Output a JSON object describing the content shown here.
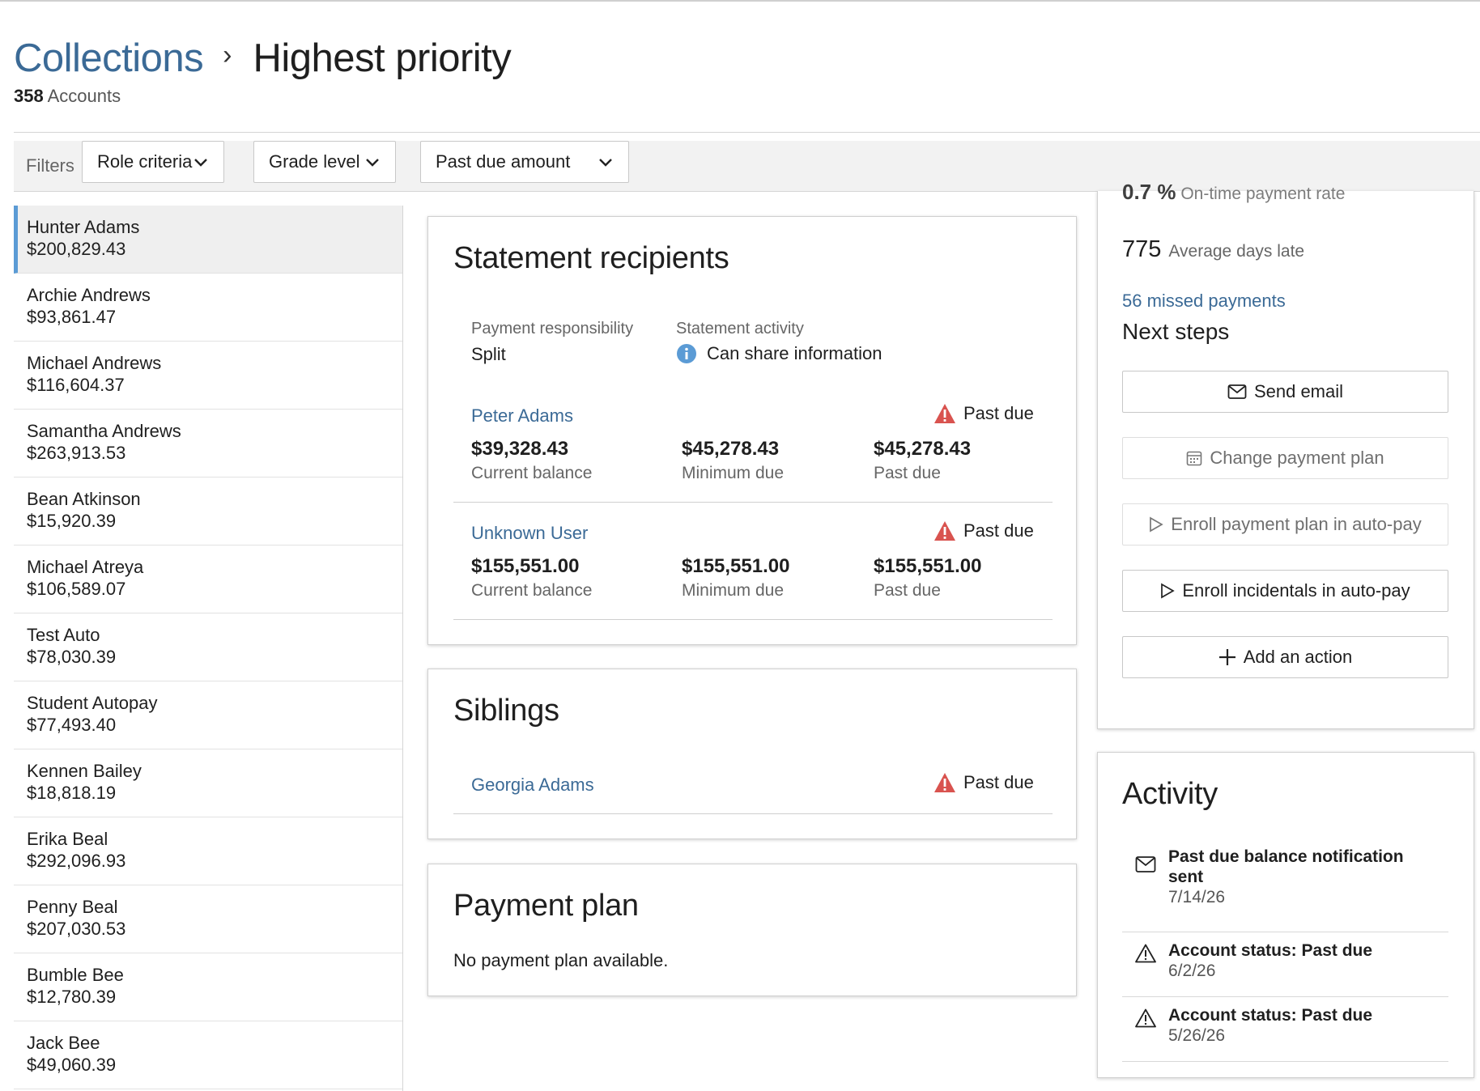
{
  "breadcrumb": {
    "parent": "Collections",
    "separator": "›",
    "current": "Highest priority"
  },
  "accounts_summary": {
    "count": "358",
    "label": "Accounts"
  },
  "filters": {
    "label": "Filters",
    "buttons": [
      "Role criteria",
      "Grade level",
      "Past due amount"
    ]
  },
  "account_list": [
    {
      "name": "Hunter Adams",
      "amount": "$200,829.43",
      "selected": true
    },
    {
      "name": "Archie Andrews",
      "amount": "$93,861.47"
    },
    {
      "name": "Michael Andrews",
      "amount": "$116,604.37"
    },
    {
      "name": "Samantha Andrews",
      "amount": "$263,913.53"
    },
    {
      "name": "Bean Atkinson",
      "amount": "$15,920.39"
    },
    {
      "name": "Michael Atreya",
      "amount": "$106,589.07"
    },
    {
      "name": "Test Auto",
      "amount": "$78,030.39"
    },
    {
      "name": "Student Autopay",
      "amount": "$77,493.40"
    },
    {
      "name": "Kennen Bailey",
      "amount": "$18,818.19"
    },
    {
      "name": "Erika Beal",
      "amount": "$292,096.93"
    },
    {
      "name": "Penny Beal",
      "amount": "$207,030.53"
    },
    {
      "name": "Bumble Bee",
      "amount": "$12,780.39"
    },
    {
      "name": "Jack Bee",
      "amount": "$49,060.39"
    }
  ],
  "statement_recipients": {
    "title": "Statement recipients",
    "payment_responsibility_label": "Payment responsibility",
    "payment_responsibility_value": "Split",
    "statement_activity_label": "Statement activity",
    "statement_activity_value": "Can share information",
    "recipients": [
      {
        "name": "Peter Adams",
        "status": "Past due",
        "current_balance": "$39,328.43",
        "current_balance_label": "Current balance",
        "minimum_due": "$45,278.43",
        "minimum_due_label": "Minimum due",
        "past_due": "$45,278.43",
        "past_due_label": "Past due"
      },
      {
        "name": "Unknown User",
        "status": "Past due",
        "current_balance": "$155,551.00",
        "current_balance_label": "Current balance",
        "minimum_due": "$155,551.00",
        "minimum_due_label": "Minimum due",
        "past_due": "$155,551.00",
        "past_due_label": "Past due"
      }
    ]
  },
  "siblings": {
    "title": "Siblings",
    "items": [
      {
        "name": "Georgia Adams",
        "status": "Past due"
      }
    ]
  },
  "payment_plan": {
    "title": "Payment plan",
    "message": "No payment plan available."
  },
  "stats": {
    "on_time_value": "0.7 %",
    "on_time_label": "On-time payment rate",
    "avg_days_value": "775",
    "avg_days_label": "Average days late",
    "missed_payments": "56 missed payments"
  },
  "next_steps": {
    "title": "Next steps",
    "actions": [
      {
        "label": "Send email",
        "icon": "mail-icon",
        "enabled": true
      },
      {
        "label": "Change payment plan",
        "icon": "calendar-icon",
        "enabled": false
      },
      {
        "label": "Enroll payment plan in auto-pay",
        "icon": "play-icon",
        "enabled": false
      },
      {
        "label": "Enroll incidentals in auto-pay",
        "icon": "play-icon",
        "enabled": true
      },
      {
        "label": "Add an action",
        "icon": "plus-icon",
        "enabled": true
      }
    ]
  },
  "activity": {
    "title": "Activity",
    "items": [
      {
        "icon": "mail-icon",
        "text": "Past due balance notification sent",
        "date": "7/14/26"
      },
      {
        "icon": "warning-icon",
        "text": "Account status: Past due",
        "date": "6/2/26"
      },
      {
        "icon": "warning-icon",
        "text": "Account status: Past due",
        "date": "5/26/26"
      }
    ]
  },
  "colors": {
    "link": "#3b6a96",
    "selected_accent": "#5b9bd5",
    "warning": "#d9534f",
    "info": "#5b9bd5"
  }
}
